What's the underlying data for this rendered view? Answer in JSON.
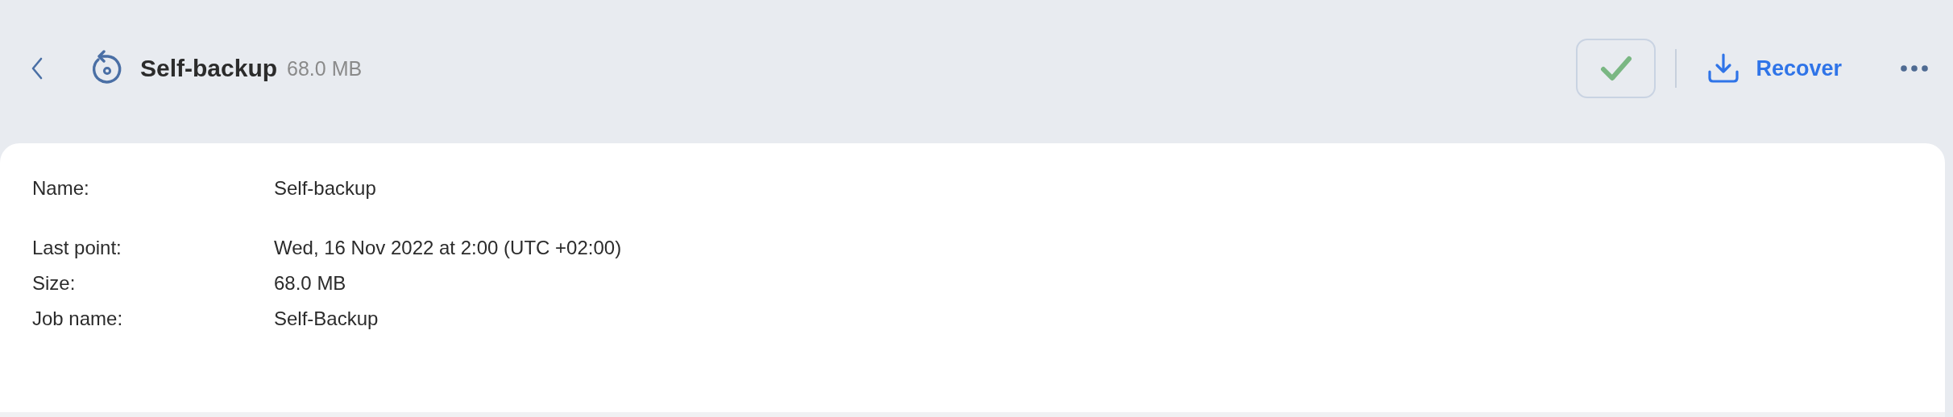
{
  "header": {
    "title": "Self-backup",
    "size": "68.0 MB",
    "actions": [
      {
        "kind": "check"
      },
      {
        "kind": "recover",
        "label": "Recover"
      },
      {
        "kind": "more"
      }
    ]
  },
  "details": {
    "sections": [
      [
        {
          "label": "Name:",
          "value": "Self-backup"
        }
      ],
      [
        {
          "label": "Last point:",
          "value": "Wed, 16 Nov 2022 at 2:00 (UTC +02:00)"
        },
        {
          "label": "Size:",
          "value": "68.0 MB"
        },
        {
          "label": "Job name:",
          "value": "Self-Backup"
        }
      ]
    ]
  }
}
